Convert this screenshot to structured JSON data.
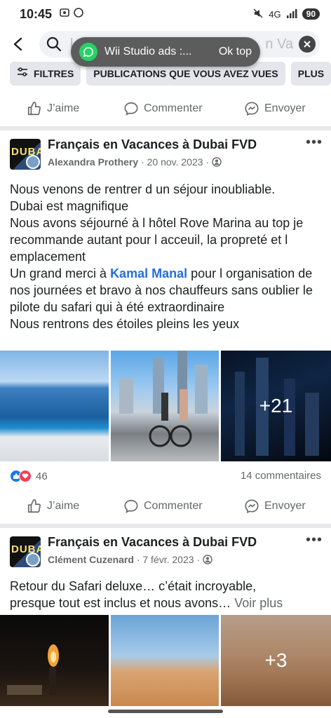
{
  "status": {
    "time": "10:45",
    "network": "4G",
    "battery": "90"
  },
  "search": {
    "partial_left": "l",
    "partial_right": "n Va"
  },
  "toast": {
    "message": "Wii Studio ads :...",
    "action": "Ok top"
  },
  "filters": [
    {
      "label": "FILTRES"
    },
    {
      "label": "PUBLICATIONS QUE VOUS AVEZ VUES"
    },
    {
      "label": "PLUS"
    }
  ],
  "actions": {
    "like": "J’aime",
    "comment": "Commenter",
    "send": "Envoyer"
  },
  "posts": [
    {
      "group": "Français en Vacances à Dubai FVD",
      "author": "Alexandra Prothery",
      "date": "20 nov. 2023",
      "text_lines": [
        "Nous venons de rentrer d un séjour inoubliable.",
        "Dubai est magnifique",
        "Nous avons séjourné à l hôtel Rove Marina au top je recommande autant pour l acceuil, la propreté et l emplacement"
      ],
      "thanks_before": "Un grand merci à ",
      "mention": "Kamal Manal",
      "thanks_after": " pour l organisation de nos journées et bravo à nos chauffeurs sans oublier le pilote du safari qui à été extraordinaire",
      "last_line": "Nous rentrons des étoiles pleins les yeux",
      "more_photos": "+21",
      "reaction_count": "46",
      "comment_count": "14 commentaires"
    },
    {
      "group": "Français en Vacances à Dubai FVD",
      "author": "Clément Cuzenard",
      "date": "7 févr. 2023",
      "text_line1": "Retour du Safari deluxe… c’était incroyable,",
      "text_line2": "presque tout est inclus et nous avons…",
      "see_more": "Voir plus",
      "more_photos": "+3"
    }
  ],
  "colors": {
    "link": "#216fdb",
    "muted": "#65676b",
    "chip_bg": "#e4e6eb",
    "like_blue": "#1877f2",
    "love_red": "#f33e58"
  }
}
